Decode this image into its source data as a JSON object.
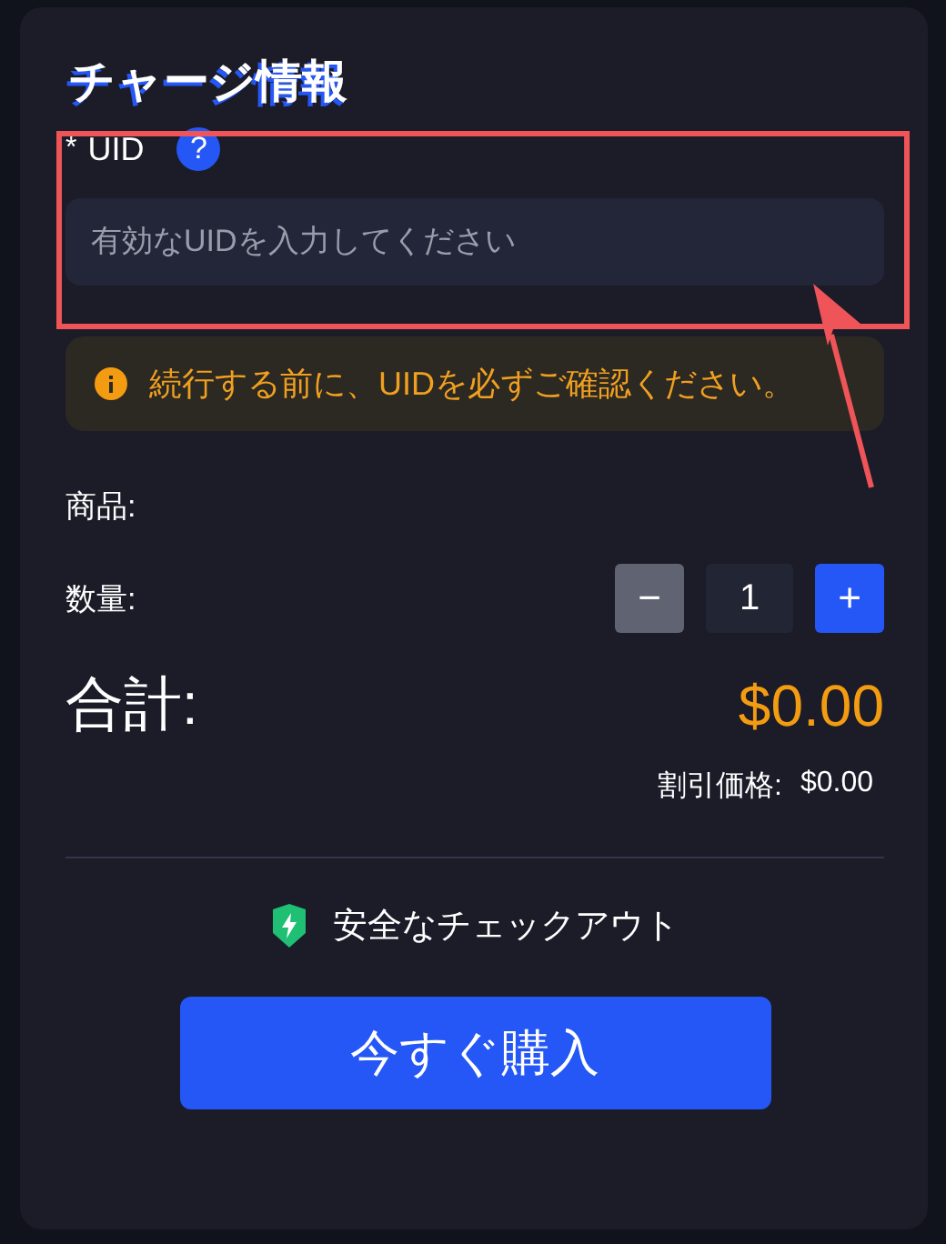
{
  "title": "チャージ情報",
  "uid": {
    "required_mark": "*",
    "label": "UID",
    "help": "?",
    "placeholder": "有効なUIDを入力してください",
    "highlighted": true
  },
  "notice": {
    "text": "続行する前に、UIDを必ずご確認ください。"
  },
  "product": {
    "label": "商品:"
  },
  "quantity": {
    "label": "数量:",
    "decrement": "−",
    "value": "1",
    "increment": "+",
    "decrement_disabled": true
  },
  "total": {
    "label": "合計:",
    "amount": "$0.00"
  },
  "discount": {
    "label": "割引価格:",
    "amount": "$0.00"
  },
  "secure": {
    "text": "安全なチェックアウト"
  },
  "buy_button": "今すぐ購入"
}
